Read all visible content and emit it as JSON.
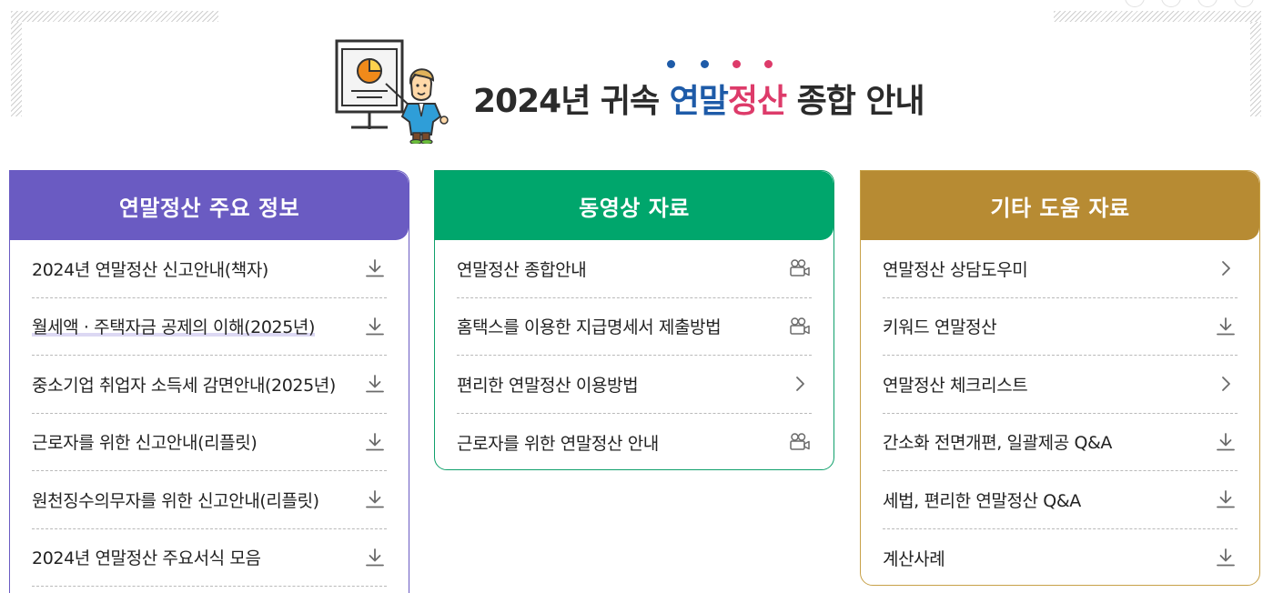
{
  "header": {
    "title_prefix": "2024년 귀속 ",
    "title_highlight_1": "연말",
    "title_highlight_2": "정산",
    "title_suffix": " 종합 안내",
    "dot_colors": [
      "#1e5ba8",
      "#1e5ba8",
      "#dd3b6a",
      "#dd3b6a"
    ]
  },
  "colors": {
    "purple": "#6a5bc2",
    "green": "#00a66c",
    "gold": "#b78b33",
    "blue": "#1e5ba8",
    "pink": "#dd3b6a"
  },
  "cards": [
    {
      "title": "연말정산 주요 정보",
      "items": [
        {
          "label": "2024년 연말정산 신고안내(책자)",
          "icon": "download-icon"
        },
        {
          "label": "월세액 · 주택자금 공제의 이해(2025년)",
          "icon": "download-icon"
        },
        {
          "label": "중소기업 취업자 소득세 감면안내(2025년)",
          "icon": "download-icon"
        },
        {
          "label": "근로자를 위한 신고안내(리플릿)",
          "icon": "download-icon"
        },
        {
          "label": "원천징수의무자를 위한 신고안내(리플릿)",
          "icon": "download-icon"
        },
        {
          "label": "2024년 연말정산 주요서식 모음",
          "icon": "download-icon"
        }
      ]
    },
    {
      "title": "동영상 자료",
      "items": [
        {
          "label": "연말정산 종합안내",
          "icon": "video-camera-icon"
        },
        {
          "label": "홈택스를 이용한 지급명세서 제출방법",
          "icon": "video-camera-icon"
        },
        {
          "label": "편리한 연말정산 이용방법",
          "icon": "chevron-right-icon"
        },
        {
          "label": "근로자를 위한 연말정산 안내",
          "icon": "video-camera-icon"
        }
      ]
    },
    {
      "title": "기타 도움 자료",
      "items": [
        {
          "label": "연말정산 상담도우미",
          "icon": "chevron-right-icon"
        },
        {
          "label": "키워드 연말정산",
          "icon": "download-icon"
        },
        {
          "label": "연말정산 체크리스트",
          "icon": "chevron-right-icon"
        },
        {
          "label": "간소화 전면개편, 일괄제공 Q&A",
          "icon": "download-icon"
        },
        {
          "label": "세법, 편리한 연말정산 Q&A",
          "icon": "download-icon"
        },
        {
          "label": "계산사례",
          "icon": "download-icon"
        }
      ]
    }
  ]
}
